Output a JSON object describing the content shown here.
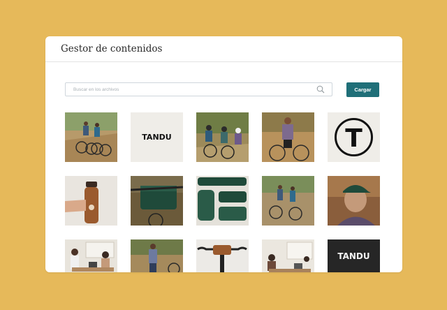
{
  "header": {
    "title": "Gestor de contenidos"
  },
  "search": {
    "placeholder": "Buscar en los archivos"
  },
  "upload": {
    "label": "Cargar"
  },
  "brand": {
    "accent": "#1f6f78",
    "background": "#e6b95a"
  },
  "logos": {
    "wordmark": "TANDU",
    "monogram": "T"
  },
  "assets": [
    {
      "name": "cyclists-trail-photo"
    },
    {
      "name": "tandu-logo-white"
    },
    {
      "name": "group-ride-photo"
    },
    {
      "name": "cyclist-posing-photo"
    },
    {
      "name": "tandu-monogram-logo"
    },
    {
      "name": "water-bottle-photo"
    },
    {
      "name": "handlebar-bag-photo"
    },
    {
      "name": "bags-flatlay-photo"
    },
    {
      "name": "riders-trail-photo"
    },
    {
      "name": "green-cap-portrait-photo"
    },
    {
      "name": "office-meeting-photo"
    },
    {
      "name": "rider-walking-photo"
    },
    {
      "name": "handlebar-closeup-photo"
    },
    {
      "name": "office-laptop-photo"
    },
    {
      "name": "tandu-logo-dark"
    }
  ]
}
